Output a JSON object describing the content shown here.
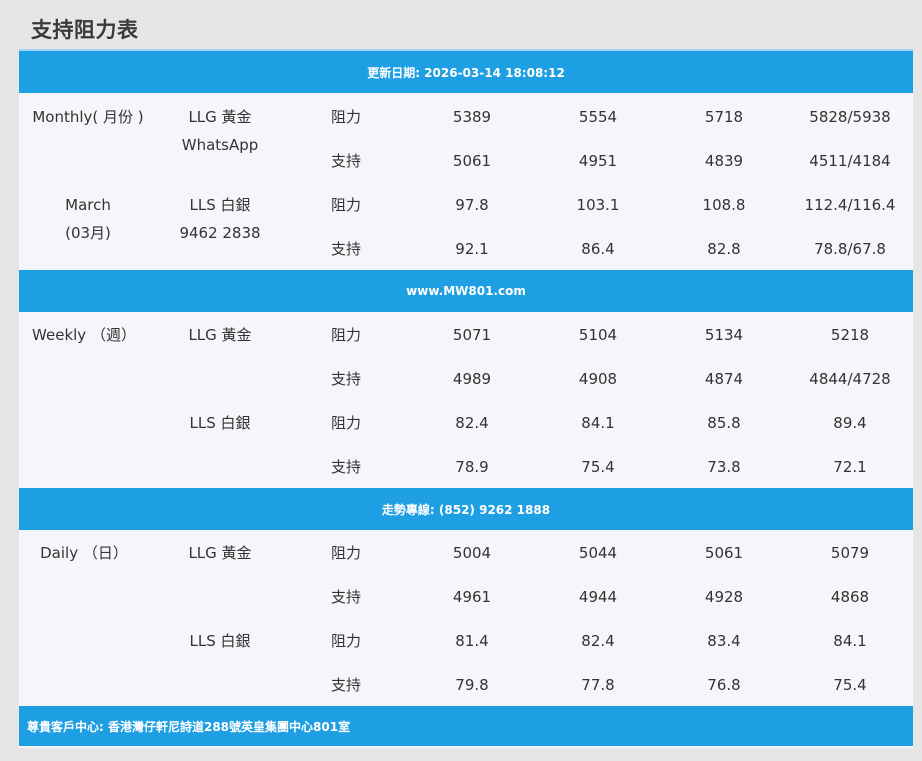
{
  "page_title": "支持阻力表",
  "banners": {
    "update": "更新日期: 2026-03-14 18:08:12",
    "website": "www.MW801.com",
    "hotline": "走勢專線: (852) 9262 1888",
    "address": "尊貴客戶中心: 香港灣仔軒尼詩道288號英皇集團中心801室"
  },
  "monthly": {
    "period_label": "Monthly( 月份 )",
    "month_label": "March",
    "month_label_cn": "(03月)",
    "gold_label": "LLG 黃金",
    "contact_label": "WhatsApp",
    "silver_label": "LLS 白銀",
    "phone": "9462 2838",
    "rows": [
      {
        "type": "阻力",
        "values": [
          "5389",
          "5554",
          "5718",
          "5828/5938"
        ]
      },
      {
        "type": "支持",
        "values": [
          "5061",
          "4951",
          "4839",
          "4511/4184"
        ]
      },
      {
        "type": "阻力",
        "values": [
          "97.8",
          "103.1",
          "108.8",
          "112.4/116.4"
        ]
      },
      {
        "type": "支持",
        "values": [
          "92.1",
          "86.4",
          "82.8",
          "78.8/67.8"
        ]
      }
    ]
  },
  "weekly": {
    "period_label": "Weekly （週）",
    "gold_label": "LLG 黃金",
    "silver_label": "LLS 白銀",
    "rows": [
      {
        "type": "阻力",
        "values": [
          "5071",
          "5104",
          "5134",
          "5218"
        ]
      },
      {
        "type": "支持",
        "values": [
          "4989",
          "4908",
          "4874",
          "4844/4728"
        ]
      },
      {
        "type": "阻力",
        "values": [
          "82.4",
          "84.1",
          "85.8",
          "89.4"
        ]
      },
      {
        "type": "支持",
        "values": [
          "78.9",
          "75.4",
          "73.8",
          "72.1"
        ]
      }
    ]
  },
  "daily": {
    "period_label": "Daily （日）",
    "gold_label": "LLG 黃金",
    "silver_label": "LLS 白銀",
    "rows": [
      {
        "type": "阻力",
        "values": [
          "5004",
          "5044",
          "5061",
          "5079"
        ]
      },
      {
        "type": "支持",
        "values": [
          "4961",
          "4944",
          "4928",
          "4868"
        ]
      },
      {
        "type": "阻力",
        "values": [
          "81.4",
          "82.4",
          "83.4",
          "84.1"
        ]
      },
      {
        "type": "支持",
        "values": [
          "79.8",
          "77.8",
          "76.8",
          "75.4"
        ]
      }
    ]
  },
  "colors": {
    "banner": "#1e9fe3",
    "panel": "#f4f6f9",
    "background": "#e6e6e6"
  }
}
